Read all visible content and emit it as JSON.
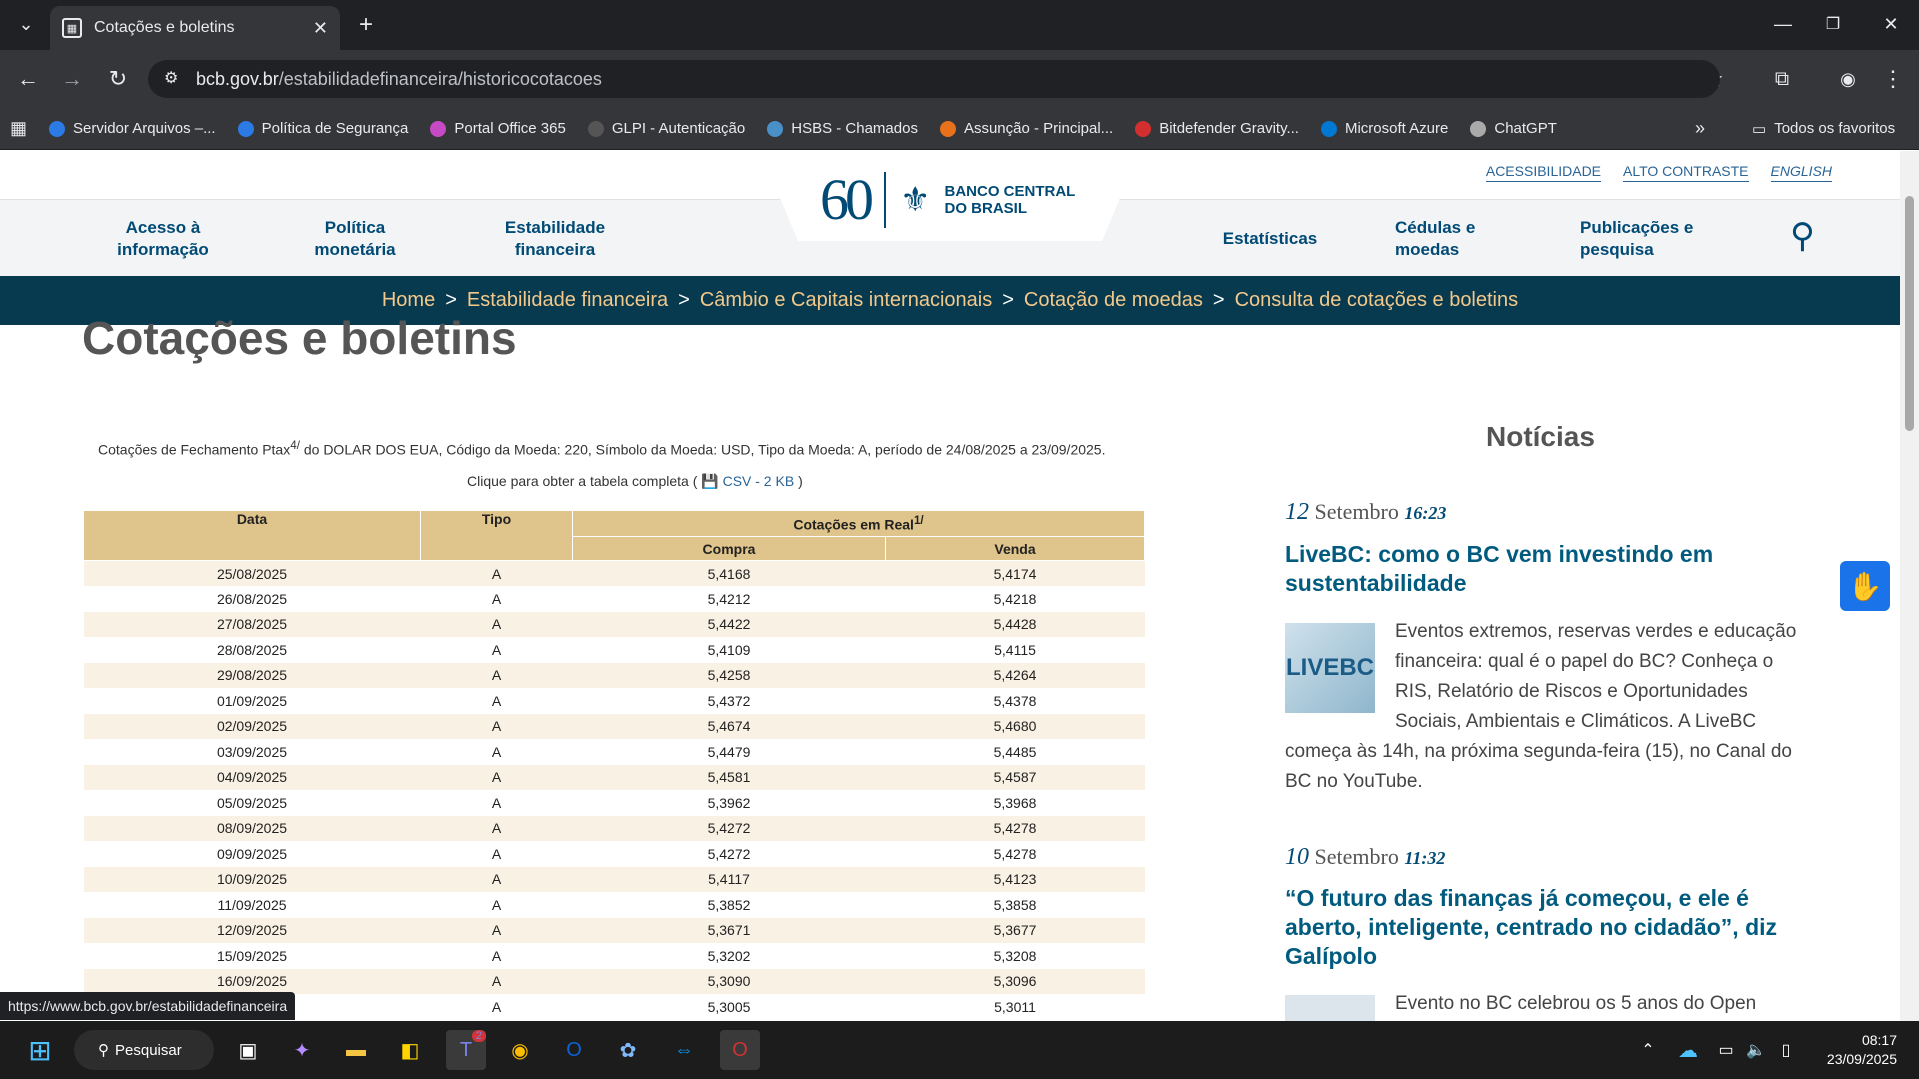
{
  "browser": {
    "tab_title": "Cotações e boletins",
    "url_host": "bcb.gov.br",
    "url_path": "/estabilidadefinanceira/historicocotacoes",
    "bookmarks": [
      "Servidor Arquivos –...",
      "Política de Segurança",
      "Portal Office 365",
      "GLPI - Autenticação",
      "HSBS - Chamados",
      "Assunção - Principal...",
      "Bitdefender Gravity...",
      "Microsoft Azure",
      "ChatGPT"
    ],
    "all_bookmarks": "Todos os favoritos",
    "status_url": "https://www.bcb.gov.br/estabilidadefinanceira"
  },
  "site": {
    "top_links": [
      "ACESSIBILIDADE",
      "ALTO CONTRASTE",
      "ENGLISH"
    ],
    "logo_mark": "60",
    "logo_name_1": "BANCO CENTRAL",
    "logo_name_2": "DO BRASIL",
    "nav": [
      "Acesso à informação",
      "Política monetária",
      "Estabilidade financeira",
      "Estatísticas",
      "Cédulas e moedas",
      "Publicações e pesquisa"
    ],
    "breadcrumb": [
      "Home",
      "Estabilidade financeira",
      "Câmbio e Capitais internacionais",
      "Cotação de moedas",
      "Consulta de cotações e boletins"
    ]
  },
  "main": {
    "title": "Cotações e boletins",
    "caption_pre": "Cotações de Fechamento Ptax",
    "caption_sup": "4/",
    "caption_post": " do DOLAR DOS EUA, Código da Moeda: 220, Símbolo da Moeda: USD, Tipo da Moeda: A, período de 24/08/2025 a 23/09/2025.",
    "csv_pre": "Clique para obter a tabela completa (",
    "csv_link": "CSV - 2 KB",
    "csv_post": ")",
    "table": {
      "h_data": "Data",
      "h_tipo": "Tipo",
      "h_cot": "Cotações em Real",
      "h_cot_sup": "1/",
      "h_compra": "Compra",
      "h_venda": "Venda",
      "rows": [
        [
          "25/08/2025",
          "A",
          "5,4168",
          "5,4174"
        ],
        [
          "26/08/2025",
          "A",
          "5,4212",
          "5,4218"
        ],
        [
          "27/08/2025",
          "A",
          "5,4422",
          "5,4428"
        ],
        [
          "28/08/2025",
          "A",
          "5,4109",
          "5,4115"
        ],
        [
          "29/08/2025",
          "A",
          "5,4258",
          "5,4264"
        ],
        [
          "01/09/2025",
          "A",
          "5,4372",
          "5,4378"
        ],
        [
          "02/09/2025",
          "A",
          "5,4674",
          "5,4680"
        ],
        [
          "03/09/2025",
          "A",
          "5,4479",
          "5,4485"
        ],
        [
          "04/09/2025",
          "A",
          "5,4581",
          "5,4587"
        ],
        [
          "05/09/2025",
          "A",
          "5,3962",
          "5,3968"
        ],
        [
          "08/09/2025",
          "A",
          "5,4272",
          "5,4278"
        ],
        [
          "09/09/2025",
          "A",
          "5,4272",
          "5,4278"
        ],
        [
          "10/09/2025",
          "A",
          "5,4117",
          "5,4123"
        ],
        [
          "11/09/2025",
          "A",
          "5,3852",
          "5,3858"
        ],
        [
          "12/09/2025",
          "A",
          "5,3671",
          "5,3677"
        ],
        [
          "15/09/2025",
          "A",
          "5,3202",
          "5,3208"
        ],
        [
          "16/09/2025",
          "A",
          "5,3090",
          "5,3096"
        ],
        [
          "",
          "A",
          "5,3005",
          "5,3011"
        ]
      ]
    }
  },
  "news": {
    "heading": "Notícias",
    "items": [
      {
        "day": "12",
        "month": "Setembro",
        "time": "16:23",
        "title": "LiveBC: como o BC vem investindo em sustentabilidade",
        "image_text": "LIVEBC",
        "body": "Eventos extremos, reservas verdes e educação financeira: qual é o papel do BC? Conheça o RIS, Relatório de Riscos e Oportunidades Sociais, Ambientais e Climáticos. A LiveBC começa às 14h, na próxima segunda-feira (15), no Canal do BC no YouTube."
      },
      {
        "day": "10",
        "month": "Setembro",
        "time": "11:32",
        "title": "“O futuro das finanças já começou, e ele é aberto, inteligente, centrado no cidadão”, diz Galípolo",
        "body": "Evento no BC celebrou os 5 anos do Open"
      }
    ]
  },
  "taskbar": {
    "search": "Pesquisar",
    "time": "08:17",
    "date": "23/09/2025",
    "teams_badge": "2"
  }
}
